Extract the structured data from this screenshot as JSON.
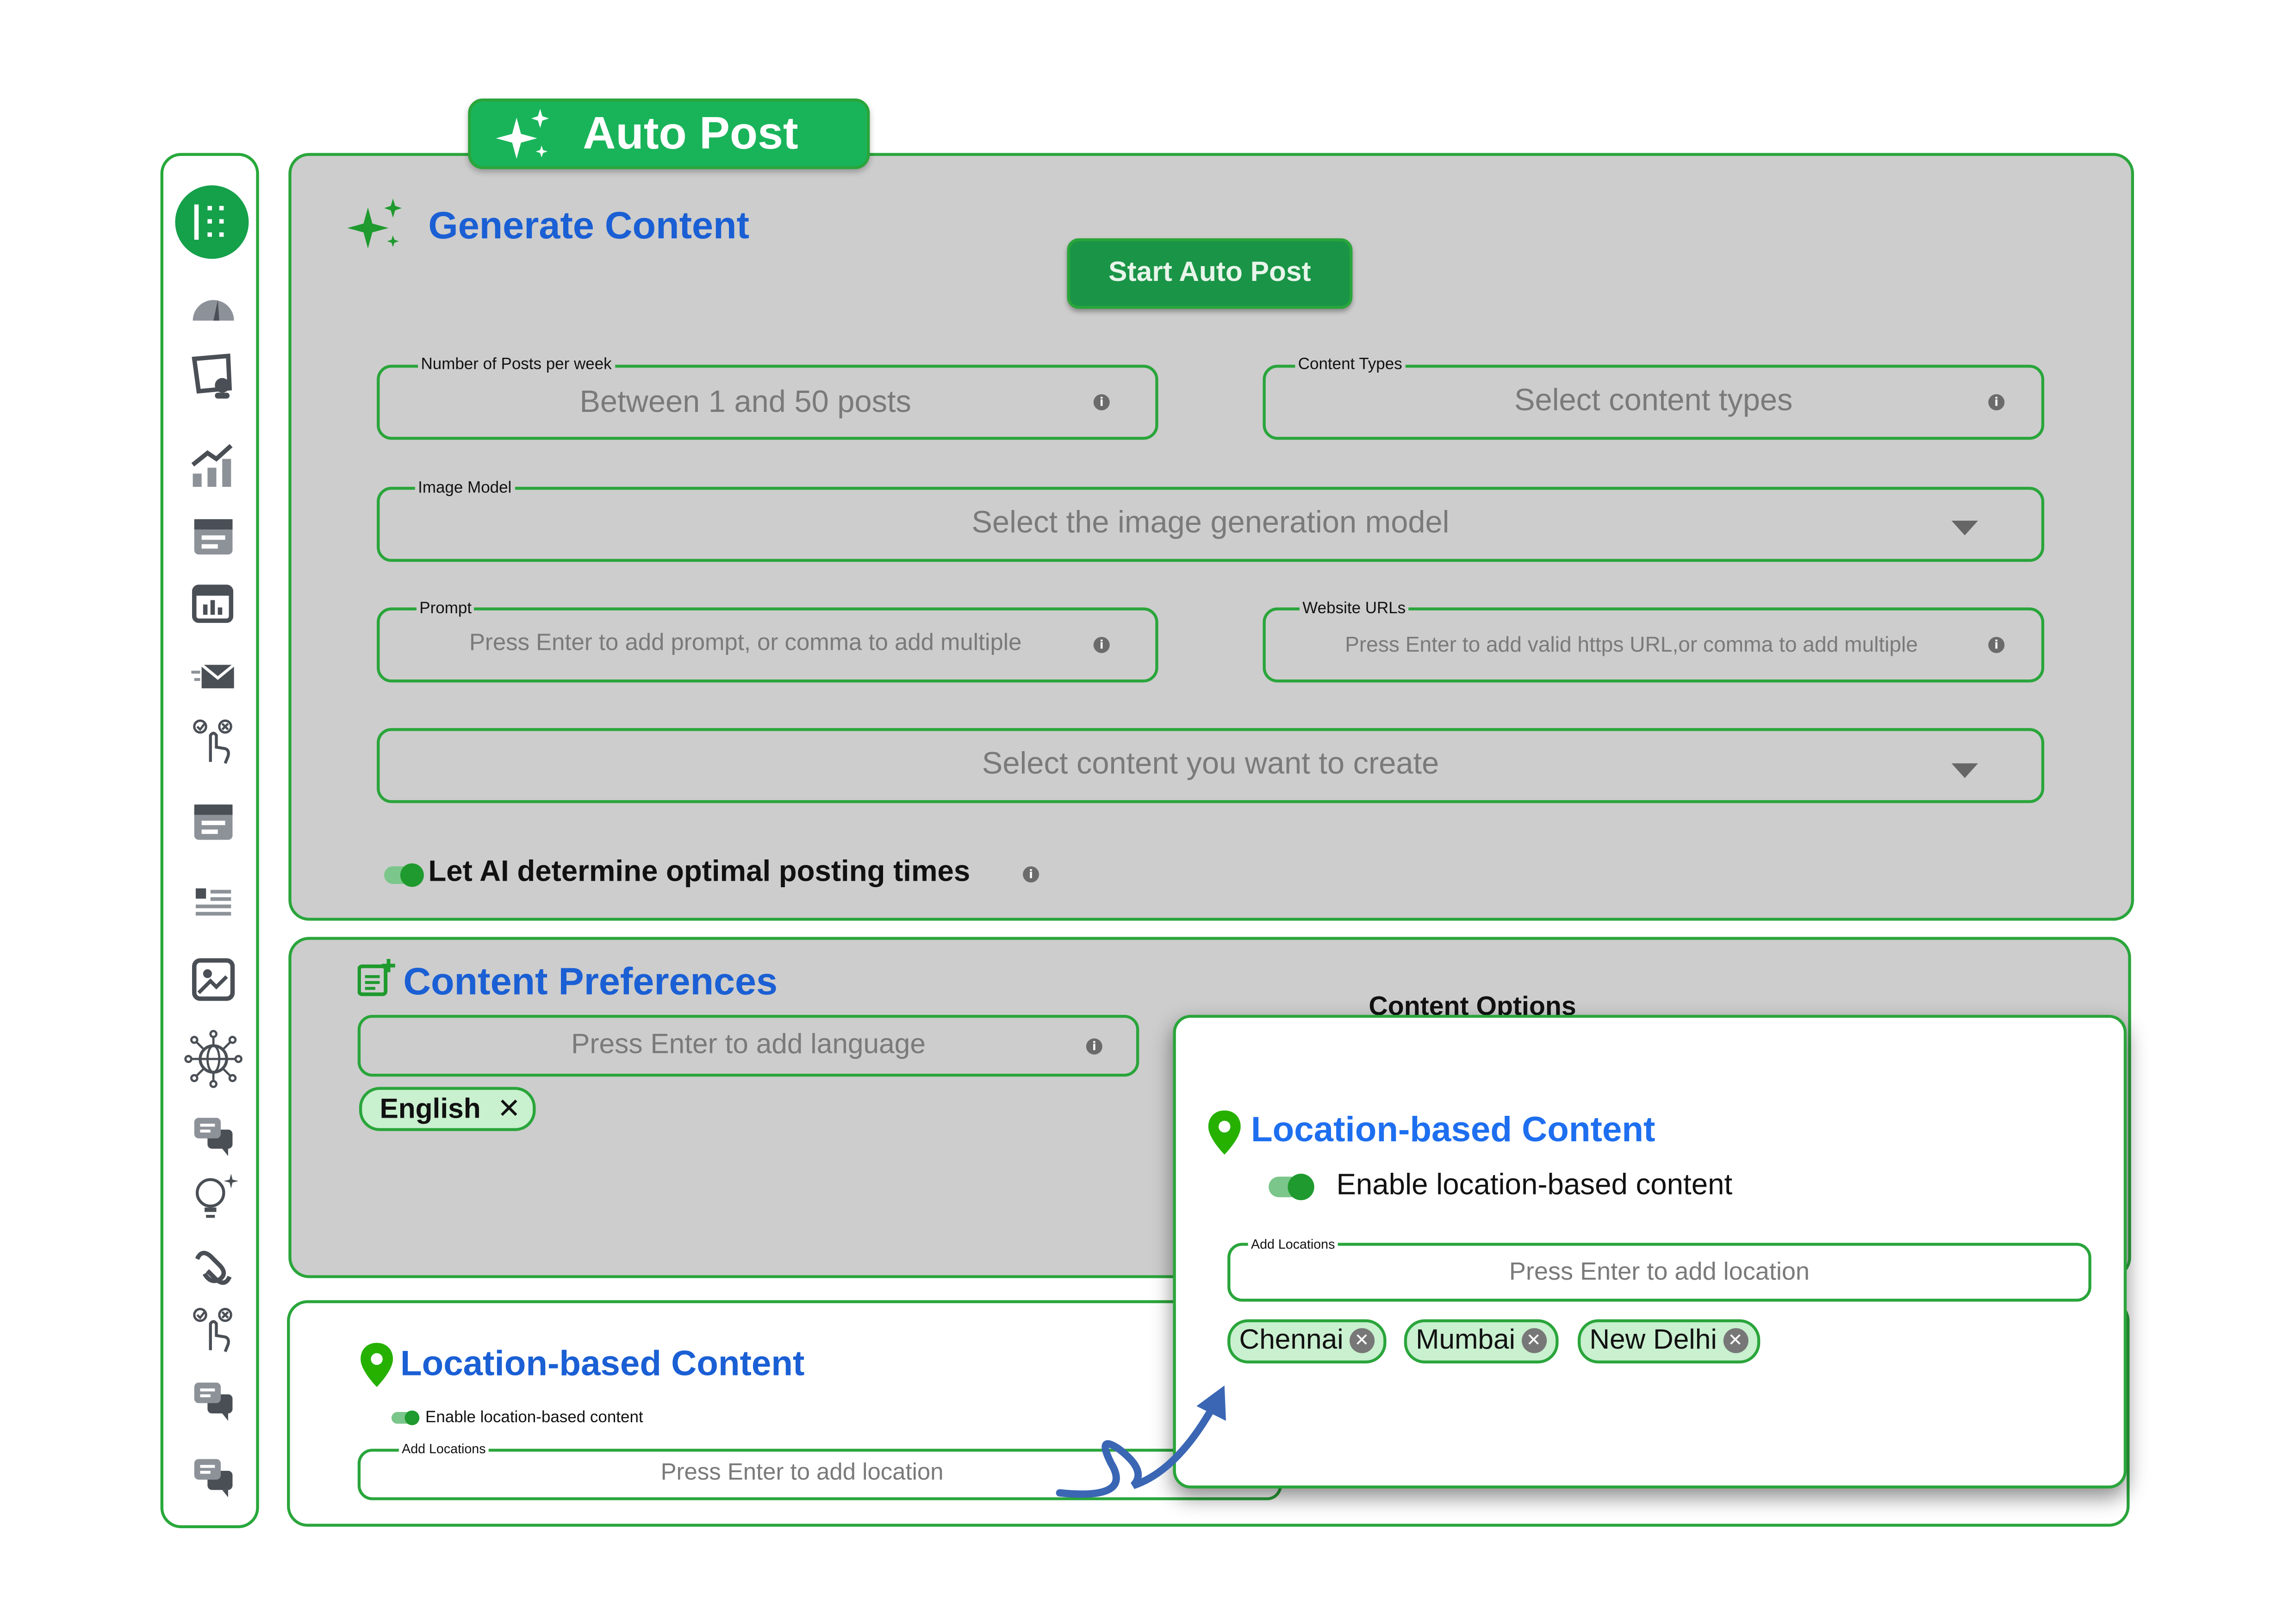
{
  "app": {
    "tab_title": "Auto Post"
  },
  "sidebar": {
    "items": [
      {
        "icon": "app-grid-icon"
      },
      {
        "icon": "speedometer-icon"
      },
      {
        "icon": "user-board-icon"
      },
      {
        "icon": "chart-growth-icon"
      },
      {
        "icon": "calendar-list-icon"
      },
      {
        "icon": "calendar-chart-icon"
      },
      {
        "icon": "mail-send-icon"
      },
      {
        "icon": "tap-select-icon"
      },
      {
        "icon": "calendar-list-icon"
      },
      {
        "icon": "text-list-icon"
      },
      {
        "icon": "image-edit-icon"
      },
      {
        "icon": "network-globe-icon"
      },
      {
        "icon": "chat-icon"
      },
      {
        "icon": "idea-bulb-icon"
      },
      {
        "icon": "link-icon"
      },
      {
        "icon": "tap-select-icon"
      },
      {
        "icon": "chat-icon"
      },
      {
        "icon": "chat-icon"
      }
    ]
  },
  "generate": {
    "title": "Generate Content",
    "start_button": "Start Auto Post",
    "posts_per_week": {
      "label": "Number of Posts per week",
      "placeholder": "Between 1 and 50 posts"
    },
    "content_types": {
      "label": "Content Types",
      "placeholder": "Select content types"
    },
    "image_model": {
      "label": "Image Model",
      "placeholder": "Select the image generation model"
    },
    "prompt": {
      "label": "Prompt",
      "placeholder": "Press Enter to add prompt, or comma to add multiple"
    },
    "website_urls": {
      "label": "Website URLs",
      "placeholder": "Press Enter to add valid https URL,or comma to add multiple"
    },
    "content_select": {
      "placeholder": "Select content you want to create"
    },
    "ai_timing_label": "Let AI determine optimal posting times"
  },
  "preferences": {
    "title": "Content Preferences",
    "language_placeholder": "Press Enter to add language",
    "languages": [
      "English"
    ],
    "options_title": "Content Options"
  },
  "location_section": {
    "title": "Location-based Content",
    "toggle_label": "Enable location-based content",
    "field_label": "Add Locations",
    "placeholder": "Press Enter to add location"
  },
  "location_popup": {
    "title": "Location-based Content",
    "toggle_label": "Enable location-based content",
    "field_label": "Add Locations",
    "placeholder": "Press Enter to add location",
    "locations": [
      "Chennai",
      "Mumbai",
      "New Delhi"
    ]
  },
  "colors": {
    "accent_green": "#19b45a",
    "border_green": "#2aa53b",
    "heading_blue": "#1a5fd4",
    "panel_gray": "#cdcdcd",
    "arrow_blue": "#3a66b4"
  }
}
